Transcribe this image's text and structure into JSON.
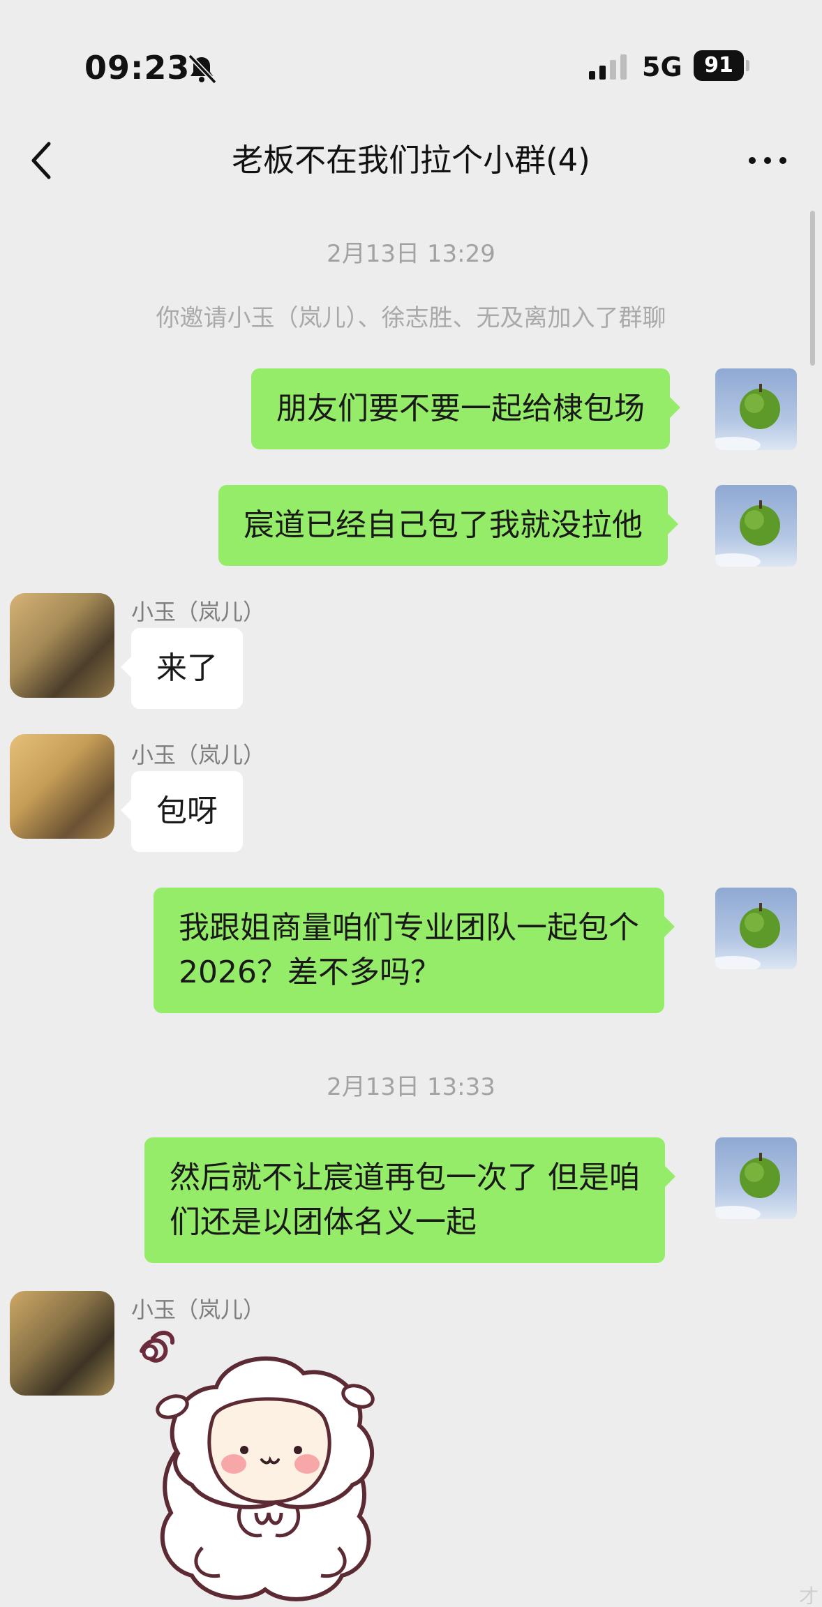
{
  "status_bar": {
    "time": "09:23",
    "network": "5G",
    "battery": "91",
    "icons": [
      "bell-mute-icon",
      "signal-icon",
      "battery-icon"
    ]
  },
  "nav": {
    "title": "老板不在我们拉个小群(4)",
    "back_icon": "chevron-left-icon",
    "more_icon": "more-dots-icon"
  },
  "messages": {
    "timestamp_1": "2月13日 13:29",
    "system_invite": "你邀请小玉（岚儿）、徐志胜、无及离加入了群聊",
    "m1": "朋友们要不要一起给棣包场",
    "m2": "宸道已经自己包了我就没拉他",
    "sender_1": "小玉（岚儿）",
    "m3": "来了",
    "sender_2": "小玉（岚儿）",
    "m4": "包呀",
    "m5": "我跟姐商量咱们专业团队一起包个\n2026？差不多吗？",
    "timestamp_2": "2月13日 13:33",
    "m6": "然后就不让宸道再包一次了 但是咱\n们还是以团体名义一起",
    "sender_3": "小玉（岚儿）",
    "sticker": "sheep-sticker",
    "corner_mark": "才"
  },
  "colors": {
    "background": "#ededed",
    "my_bubble": "#95ec69",
    "other_bubble": "#ffffff",
    "timestamp_text": "#a2a2a2"
  }
}
